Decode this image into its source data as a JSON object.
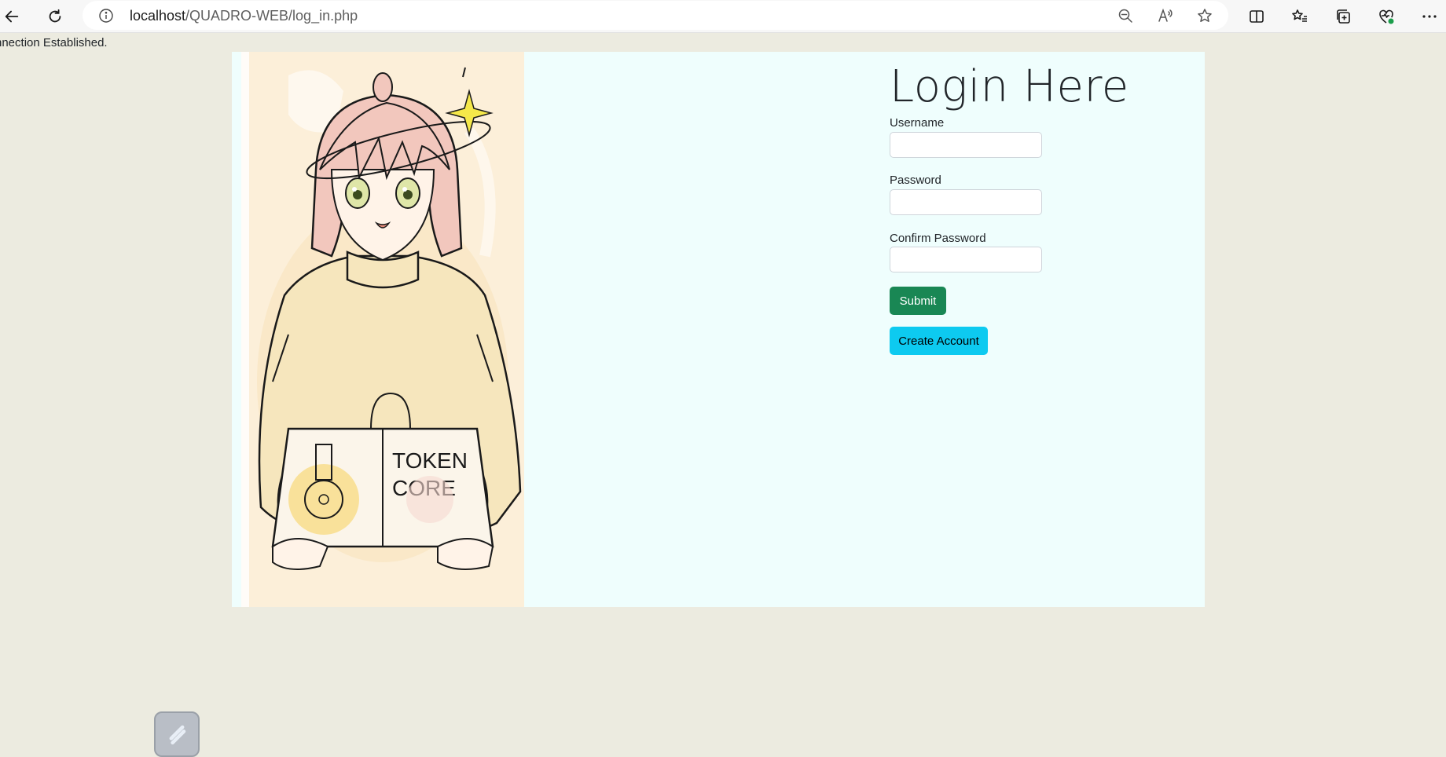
{
  "browser": {
    "url_host": "localhost",
    "url_path": "/QUADRO-WEB/log_in.php"
  },
  "page": {
    "status": "nnection Established."
  },
  "login": {
    "title": "Login Here",
    "username_label": "Username",
    "password_label": "Password",
    "confirm_label": "Confirm Password",
    "username_value": "",
    "password_value": "",
    "confirm_value": "",
    "submit_label": "Submit",
    "create_label": "Create Account"
  },
  "hero": {
    "illustration": "anime-girl-holding-token-core-bag",
    "bag_text_line1": "TOKEN",
    "bag_text_line2": "CORE"
  },
  "colors": {
    "page_bg": "#ecebe0",
    "card_bg": "#effefd",
    "submit_bg": "#198754",
    "create_bg": "#0dcaf0"
  },
  "icons": [
    "back-arrow-icon",
    "refresh-icon",
    "info-icon",
    "zoom-out-icon",
    "read-aloud-icon",
    "favorite-star-icon",
    "split-screen-icon",
    "favorites-list-icon",
    "collections-icon",
    "browser-essentials-icon",
    "more-menu-icon",
    "app-launcher-icon"
  ]
}
